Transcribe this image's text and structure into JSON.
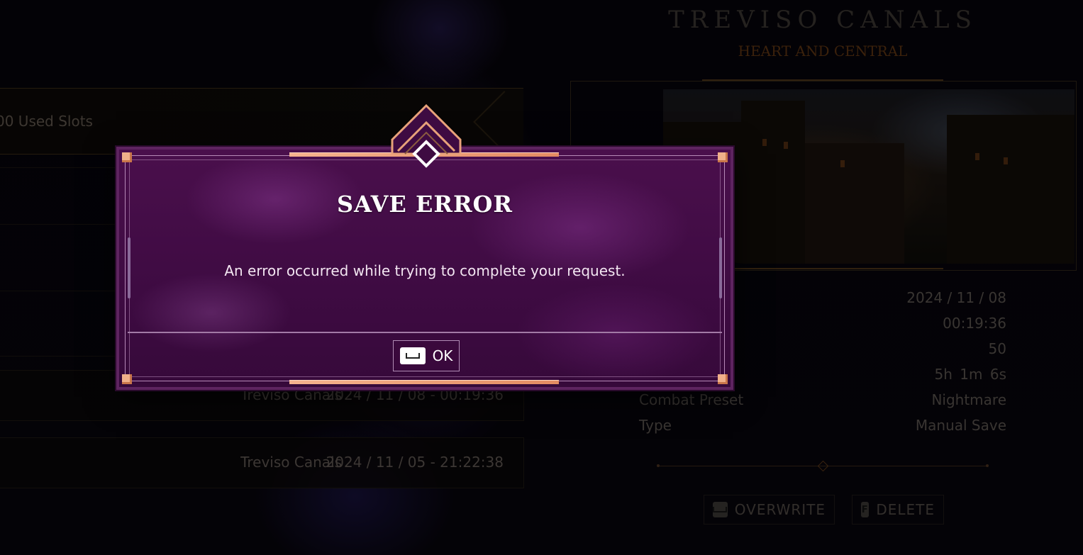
{
  "save_list": {
    "slots_label": "00 Used Slots",
    "rows": [
      {
        "location": "Treviso Canals",
        "timestamp": "2024 / 11 / 08 - 00:19:36"
      },
      {
        "location": "Treviso Canals",
        "timestamp": "2024 / 11 / 05 - 21:22:38"
      }
    ]
  },
  "details": {
    "location_title": "TREVISO CANALS",
    "location_subtitle": "HEART AND CENTRAL",
    "stats": [
      {
        "label": "",
        "value": "2024 / 11 / 08"
      },
      {
        "label": "",
        "value": "00:19:36"
      },
      {
        "label": "",
        "value": "50"
      },
      {
        "label": "",
        "value": "5h  1m  6s"
      },
      {
        "label": "Combat Preset",
        "value": "Nightmare"
      },
      {
        "label": "Type",
        "value": "Manual Save"
      }
    ],
    "actions": {
      "overwrite_label": "OVERWRITE",
      "delete_label": "DELETE",
      "delete_key": "F"
    }
  },
  "dialog": {
    "title": "SAVE ERROR",
    "message": "An error occurred while trying to complete your request.",
    "ok_label": "OK"
  },
  "colors": {
    "dialog_bg": "#4a0f4c",
    "accent_copper": "#f0b08a",
    "frame_lilac": "#b78ab8"
  }
}
